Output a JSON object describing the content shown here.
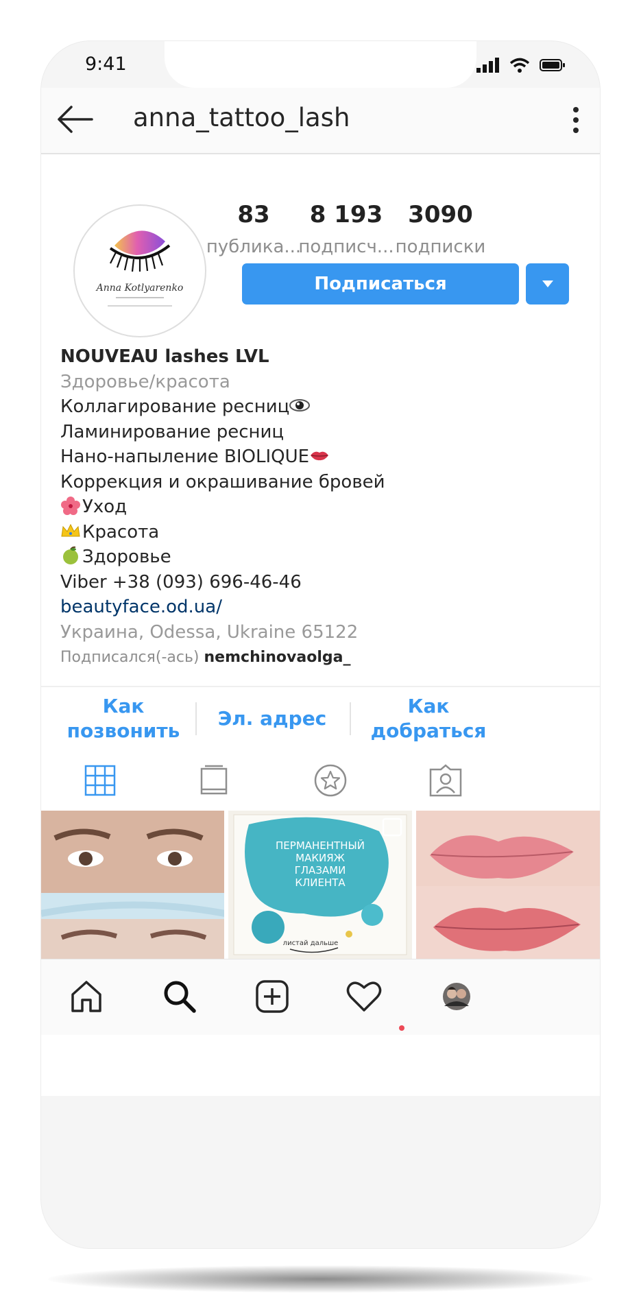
{
  "status_bar": {
    "time": "9:41"
  },
  "header": {
    "username": "anna_tattoo_lash"
  },
  "profile": {
    "avatar_logo_text": "Anna Kotlyarenko",
    "stats": [
      {
        "value": "83",
        "label": "публика..."
      },
      {
        "value": "8 193",
        "label": "подписч..."
      },
      {
        "value": "3090",
        "label": "подписки"
      }
    ],
    "follow_label": "Подписаться"
  },
  "bio": {
    "name": "NOUVEAU lashes LVL",
    "category": "Здоровье/красота",
    "lines": [
      {
        "text": "Коллагирование ресниц",
        "emoji_after": "eye-icon"
      },
      {
        "text": "Ламинирование ресниц"
      },
      {
        "text": "Нано-напыление BIOLIQUE",
        "emoji_after": "lips-icon"
      },
      {
        "text": "Коррекция и окрашивание бровей"
      },
      {
        "text": "Уход",
        "emoji_before": "hibiscus-icon"
      },
      {
        "text": "Красота",
        "emoji_before": "crown-icon"
      },
      {
        "text": "Здоровье",
        "emoji_before": "apple-icon"
      },
      {
        "text": "Viber +38 (093) 696-46-46"
      }
    ],
    "website": "beautyface.od.ua/",
    "location": "Украина, Odessa, Ukraine 65122",
    "followed_by_prefix": "Подписался(-ась)",
    "followed_by_user": "nemchinovaolga_"
  },
  "contact_buttons": [
    {
      "label_line1": "Как",
      "label_line2": "позвонить"
    },
    {
      "label_line1": "Эл. адрес",
      "label_line2": ""
    },
    {
      "label_line1": "Как",
      "label_line2": "добраться"
    }
  ],
  "tabs": [
    "grid-icon",
    "tv-icon",
    "star-icon",
    "tagged-icon"
  ],
  "posts": [
    {
      "image": "brows-before-after"
    },
    {
      "image": "permanent-makeup-card",
      "text": "ПЕРМАНЕНТНЫЙ МАКИЯЖ ГЛАЗАМИ КЛИЕНТА",
      "caption": "листай дальше"
    },
    {
      "image": "lips-before-after"
    }
  ],
  "bottom_nav": [
    "home-icon",
    "search-icon",
    "add-post-icon",
    "heart-icon",
    "profile-avatar"
  ],
  "colors": {
    "accent": "#3897f0",
    "text": "#262626",
    "secondary": "#8e8e8e",
    "link": "#003569",
    "notification_dot": "#ed4956"
  }
}
